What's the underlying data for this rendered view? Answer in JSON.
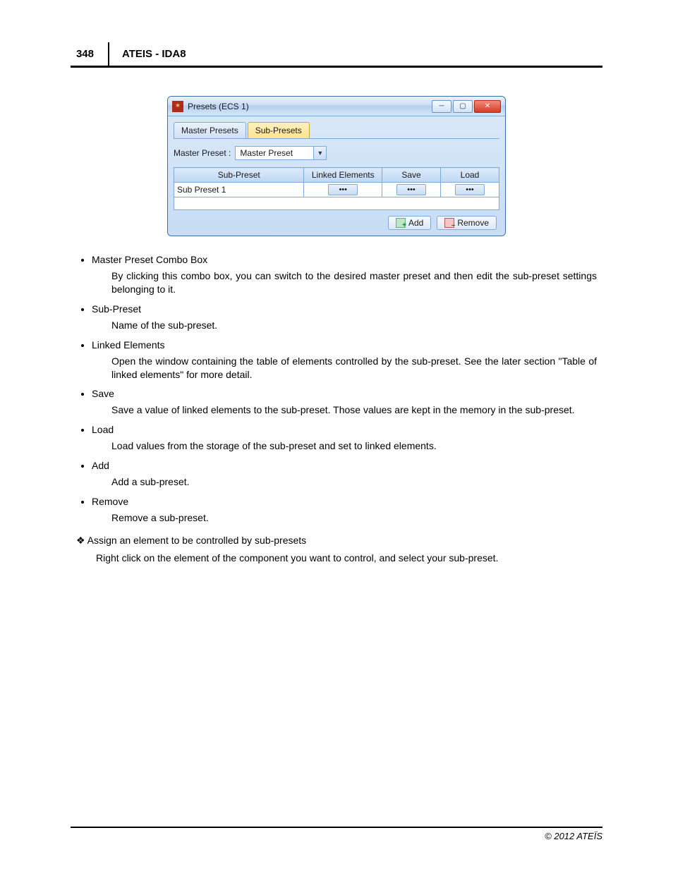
{
  "page": {
    "number": "348",
    "title": "ATEIS - IDA8",
    "copyright": "© 2012 ATEÏS"
  },
  "dialog": {
    "title": "Presets (ECS 1)",
    "tabs": {
      "master": "Master Presets",
      "sub": "Sub-Presets"
    },
    "combo_label": "Master Preset :",
    "combo_value": "Master Preset",
    "columns": {
      "sub_preset": "Sub-Preset",
      "linked_elements": "Linked Elements",
      "save": "Save",
      "load": "Load"
    },
    "row1": {
      "name": "Sub Preset 1",
      "dots": "•••"
    },
    "buttons": {
      "add": "Add",
      "remove": "Remove"
    }
  },
  "bullets": [
    {
      "name": "Master Preset Combo Box",
      "desc": "By clicking this combo box, you can switch to the desired master preset and then edit the sub-preset settings belonging to it."
    },
    {
      "name": "Sub-Preset",
      "desc": "Name of the sub-preset."
    },
    {
      "name": "Linked Elements",
      "desc": "Open the window containing the table of elements controlled by the sub-preset. See the later section \"Table of  linked elements\" for more detail."
    },
    {
      "name": "Save",
      "desc": "Save a value of linked elements to the sub-preset. Those values are kept in the memory in the sub-preset."
    },
    {
      "name": "Load",
      "desc": "Load values from the storage of the sub-preset and set to linked elements."
    },
    {
      "name": "Add",
      "desc": "Add a sub-preset."
    },
    {
      "name": "Remove",
      "desc": "Remove a sub-preset."
    }
  ],
  "section": {
    "title": "Assign an element to be controlled by sub-presets",
    "desc": "Right click on the element of the component you want to control, and select your sub-preset."
  }
}
